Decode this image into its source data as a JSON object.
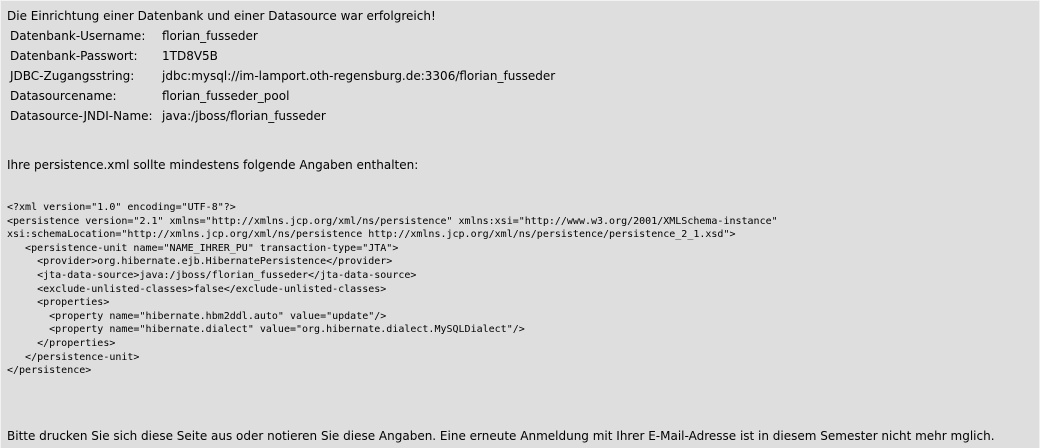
{
  "success_message": "Die Einrichtung einer Datenbank und einer Datasource war erfolgreich!",
  "info": [
    {
      "label": "Datenbank-Username:",
      "value": "florian_fusseder"
    },
    {
      "label": "Datenbank-Passwort:",
      "value": "1TD8V5B"
    },
    {
      "label": "JDBC-Zugangsstring:",
      "value": "jdbc:mysql://im-lamport.oth-regensburg.de:3306/florian_fusseder"
    },
    {
      "label": "Datasourcename:",
      "value": "florian_fusseder_pool"
    },
    {
      "label": "Datasource-JNDI-Name:",
      "value": "java:/jboss/florian_fusseder"
    }
  ],
  "persistence_intro": "Ihre persistence.xml sollte mindestens folgende Angaben enthalten:",
  "persistence_xml": "<?xml version=\"1.0\" encoding=\"UTF-8\"?>\n<persistence version=\"2.1\" xmlns=\"http://xmlns.jcp.org/xml/ns/persistence\" xmlns:xsi=\"http://www.w3.org/2001/XMLSchema-instance\"\nxsi:schemaLocation=\"http://xmlns.jcp.org/xml/ns/persistence http://xmlns.jcp.org/xml/ns/persistence/persistence_2_1.xsd\">\n   <persistence-unit name=\"NAME_IHRER_PU\" transaction-type=\"JTA\">\n     <provider>org.hibernate.ejb.HibernatePersistence</provider>\n     <jta-data-source>java:/jboss/florian_fusseder</jta-data-source>\n     <exclude-unlisted-classes>false</exclude-unlisted-classes>\n     <properties>\n       <property name=\"hibernate.hbm2ddl.auto\" value=\"update\"/>\n       <property name=\"hibernate.dialect\" value=\"org.hibernate.dialect.MySQLDialect\"/>\n     </properties>\n   </persistence-unit>\n</persistence>",
  "notice": "Bitte drucken Sie sich diese Seite aus oder notieren Sie diese Angaben. Eine erneute Anmeldung mit Ihrer E-Mail-Adresse ist in diesem Semester nicht mehr mglich."
}
